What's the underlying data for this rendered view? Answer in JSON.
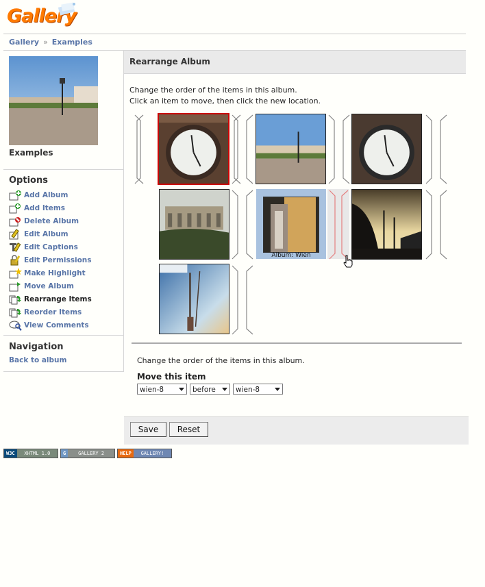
{
  "logo": {
    "text": "Gallery"
  },
  "breadcrumb": {
    "items": [
      "Gallery",
      "Examples"
    ],
    "separator": "»"
  },
  "sidebar": {
    "album_title": "Examples",
    "options_heading": "Options",
    "options": [
      {
        "label": "Add Album",
        "icon": "add-album-icon"
      },
      {
        "label": "Add Items",
        "icon": "add-items-icon"
      },
      {
        "label": "Delete Album",
        "icon": "delete-album-icon"
      },
      {
        "label": "Edit Album",
        "icon": "edit-album-icon"
      },
      {
        "label": "Edit Captions",
        "icon": "edit-captions-icon"
      },
      {
        "label": "Edit Permissions",
        "icon": "edit-permissions-icon"
      },
      {
        "label": "Make Highlight",
        "icon": "make-highlight-icon"
      },
      {
        "label": "Move Album",
        "icon": "move-album-icon"
      },
      {
        "label": "Rearrange Items",
        "icon": "rearrange-items-icon",
        "current": true
      },
      {
        "label": "Reorder Items",
        "icon": "reorder-items-icon"
      },
      {
        "label": "View Comments",
        "icon": "view-comments-icon"
      }
    ],
    "navigation_heading": "Navigation",
    "back_link": "Back to album"
  },
  "main": {
    "title": "Rearrange Album",
    "desc_line1": "Change the order of the items in this album.",
    "desc_line2": "Click an item to move, then click the new location.",
    "album_caption": "Album: Wien",
    "desc_bottom": "Change the order of the items in this album.",
    "move_label": "Move this item",
    "select_item": "wien-8",
    "select_position": "before",
    "select_target": "wien-8",
    "save_label": "Save",
    "reset_label": "Reset"
  },
  "badges": [
    {
      "left": "W3C",
      "right": "XHTML 1.0",
      "left_color": "#0a4a7a",
      "right_color": "#7a8a7a"
    },
    {
      "left": "G",
      "right": "GALLERY 2",
      "left_color": "#6f97c3",
      "right_color": "#8a8f8a"
    },
    {
      "left": "HELP",
      "right": "GALLERY!",
      "left_color": "#e86a10",
      "right_color": "#6f88b3"
    }
  ],
  "colors": {
    "link": "#5a76a8",
    "selection_border": "#cc0000",
    "album_highlight": "#a9c2df"
  }
}
